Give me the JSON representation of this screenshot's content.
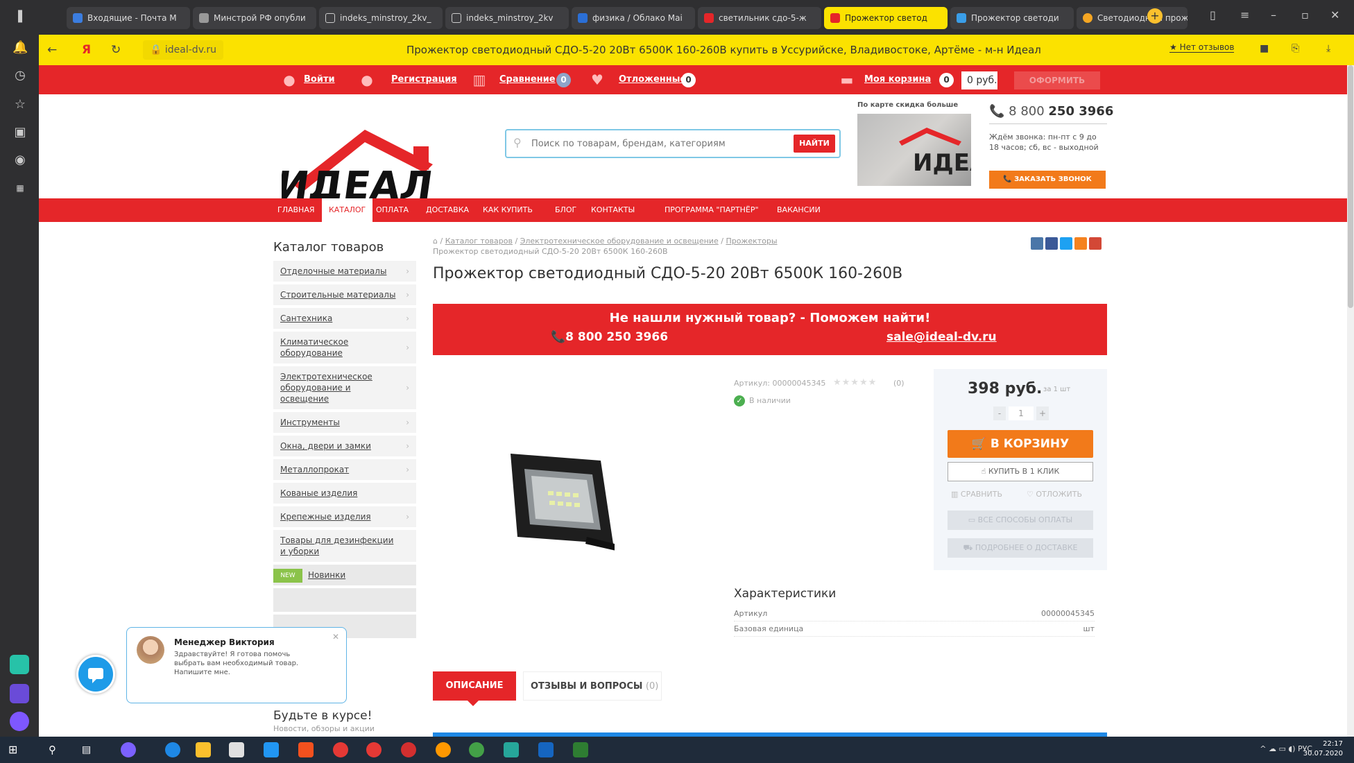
{
  "browser": {
    "tabs": [
      {
        "label": "Входящие - Почта М"
      },
      {
        "label": "Минстрой РФ опубли"
      },
      {
        "label": "indeks_minstroy_2kv_"
      },
      {
        "label": "indeks_minstroy_2kv"
      },
      {
        "label": "физика / Облако Mai"
      },
      {
        "label": "светильник сдо-5-ж"
      },
      {
        "label": "Прожектор светод"
      },
      {
        "label": "Прожектор светоди"
      },
      {
        "label": "Светодиодный прож"
      }
    ],
    "domain": "ideal-dv.ru",
    "page_title": "Прожектор светодиодный СДО-5-20 20Вт 6500К 160-260В купить в Уссурийске, Владивостоке, Артёме - м-н Идеал",
    "reviews_button": "★ Нет отзывов"
  },
  "topbar": {
    "login": "Войти",
    "register": "Регистрация",
    "compare": "Сравнение",
    "compare_count": "0",
    "deferred": "Отложенные",
    "deferred_count": "0",
    "cart": "Моя корзина",
    "cart_count": "0",
    "cart_sum": "0 руб.",
    "checkout": "ОФОРМИТЬ"
  },
  "header": {
    "logo_text": "ИДЕАЛ",
    "search_placeholder": "Поиск по товарам, брендам, категориям",
    "search_button": "НАЙТИ",
    "promo_caption": "По карте скидка больше",
    "phone_prefix": "8 800",
    "phone_number": "250 3966",
    "hours": "Ждём звонка: пн-пт с 9 до 18 часов; сб, вс - выходной",
    "callback_button": "ЗАКАЗАТЬ ЗВОНОК"
  },
  "nav": [
    "ГЛАВНАЯ",
    "КАТАЛОГ",
    "ОПЛАТА",
    "ДОСТАВКА",
    "КАК КУПИТЬ",
    "БЛОГ",
    "КОНТАКТЫ",
    "ПРОГРАММА \"ПАРТНЁР\"",
    "ВАКАНСИИ"
  ],
  "sidebar": {
    "title": "Каталог товаров",
    "items": [
      "Отделочные материалы",
      "Строительные материалы",
      "Сантехника",
      "Климатическое оборудование",
      "Электротехническое оборудование и освещение",
      "Инструменты",
      "Окна, двери и замки",
      "Металлопрокат",
      "Кованые изделия",
      "Крепежные изделия",
      "Товары для дезинфекции и уборки"
    ],
    "new_badge": "NEW",
    "new_label": "Новинки",
    "news_title": "Будьте в курсе!",
    "news_sub": "Новости, обзоры и акции"
  },
  "breadcrumb": [
    "Каталог товаров",
    "Электротехническое оборудование и освещение",
    "Прожекторы",
    "Прожектор светодиодный СДО-5-20 20Вт 6500К 160-260В"
  ],
  "product": {
    "title": "Прожектор светодиодный СДО-5-20 20Вт 6500К 160-260В",
    "sku_label": "Артикул: 00000045345",
    "rating_count": "(0)",
    "stock": "В наличии",
    "price": "398 руб.",
    "unit": "за 1 шт",
    "qty": "1",
    "add_to_cart": "В КОРЗИНУ",
    "one_click": "КУПИТЬ В 1 КЛИК",
    "compare": "СРАВНИТЬ",
    "defer": "ОТЛОЖИТЬ",
    "payment": "ВСЕ СПОСОБЫ ОПЛАТЫ",
    "delivery": "ПОДРОБНЕЕ О ДОСТАВКЕ"
  },
  "banner": {
    "title": "Не нашли нужный товар? - Поможем найти!",
    "phone": "8 800 250 3966",
    "email": "sale@ideal-dv.ru"
  },
  "characteristics": {
    "title": "Характеристики",
    "rows": [
      {
        "k": "Артикул",
        "v": "00000045345"
      },
      {
        "k": "Базовая единица",
        "v": "шт"
      }
    ]
  },
  "tabs": {
    "description": "ОПИСАНИЕ",
    "reviews": "ОТЗЫВЫ И ВОПРОСЫ",
    "reviews_count": "(0)"
  },
  "chat": {
    "name": "Менеджер Виктория",
    "message": "Здравствуйте! Я готова помочь выбрать вам необходимый товар. Напишите мне."
  },
  "taskbar": {
    "lang": "РУС",
    "time": "22:17",
    "date": "30.07.2020"
  },
  "colors": {
    "brand_red": "#e52629",
    "accent_orange": "#f27a1a",
    "browser_yellow": "#fbe200"
  }
}
